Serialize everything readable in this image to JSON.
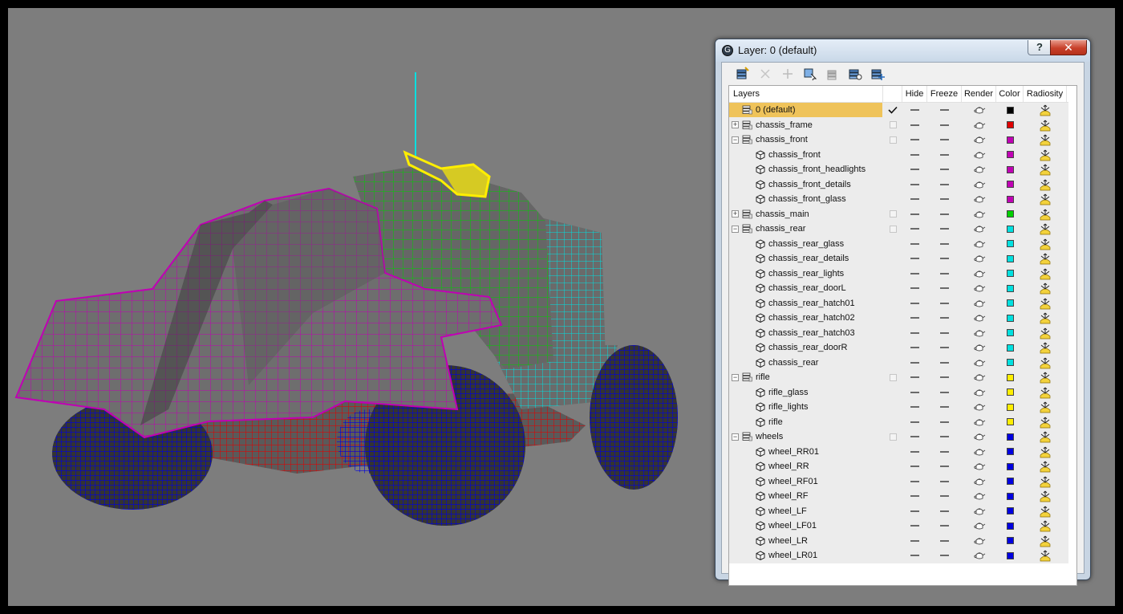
{
  "dialog": {
    "title": "Layer: 0 (default)",
    "help_label": "?",
    "close_label": "✕",
    "app_icon_label": "G"
  },
  "toolbar": {
    "buttons": [
      {
        "name": "create-layer-icon"
      },
      {
        "name": "delete-layer-icon"
      },
      {
        "name": "add-selected-icon"
      },
      {
        "name": "select-objects-icon"
      },
      {
        "name": "highlight-icon"
      },
      {
        "name": "hide-unhide-all-icon"
      },
      {
        "name": "freeze-unfreeze-all-icon"
      }
    ]
  },
  "columns": {
    "layers": "Layers",
    "hide": "Hide",
    "freeze": "Freeze",
    "render": "Render",
    "color": "Color",
    "radiosity": "Radiosity"
  },
  "colors": {
    "black": "#000000",
    "red": "#e00000",
    "magenta": "#c000b4",
    "green": "#00d000",
    "cyan": "#00e0e0",
    "yellow": "#ffee00",
    "blue": "#0000e0"
  },
  "rows": [
    {
      "label": "0 (default)",
      "kind": "layer",
      "level": 0,
      "expander": "",
      "color": "#000000",
      "selected": true,
      "current": true
    },
    {
      "label": "chassis_frame",
      "kind": "layer",
      "level": 0,
      "expander": "+",
      "color": "#e00000"
    },
    {
      "label": "chassis_front",
      "kind": "layer",
      "level": 0,
      "expander": "−",
      "color": "#c000b4"
    },
    {
      "label": "chassis_front",
      "kind": "object",
      "level": 1,
      "color": "#c000b4"
    },
    {
      "label": "chassis_front_headlights",
      "kind": "object",
      "level": 1,
      "color": "#c000b4"
    },
    {
      "label": "chassis_front_details",
      "kind": "object",
      "level": 1,
      "color": "#c000b4"
    },
    {
      "label": "chassis_front_glass",
      "kind": "object",
      "level": 1,
      "color": "#c000b4"
    },
    {
      "label": "chassis_main",
      "kind": "layer",
      "level": 0,
      "expander": "+",
      "color": "#00d000"
    },
    {
      "label": "chassis_rear",
      "kind": "layer",
      "level": 0,
      "expander": "−",
      "color": "#00e0e0"
    },
    {
      "label": "chassis_rear_glass",
      "kind": "object",
      "level": 1,
      "color": "#00e0e0"
    },
    {
      "label": "chassis_rear_details",
      "kind": "object",
      "level": 1,
      "color": "#00e0e0"
    },
    {
      "label": "chassis_rear_lights",
      "kind": "object",
      "level": 1,
      "color": "#00e0e0"
    },
    {
      "label": "chassis_rear_doorL",
      "kind": "object",
      "level": 1,
      "color": "#00e0e0"
    },
    {
      "label": "chassis_rear_hatch01",
      "kind": "object",
      "level": 1,
      "color": "#00e0e0"
    },
    {
      "label": "chassis_rear_hatch02",
      "kind": "object",
      "level": 1,
      "color": "#00e0e0"
    },
    {
      "label": "chassis_rear_hatch03",
      "kind": "object",
      "level": 1,
      "color": "#00e0e0"
    },
    {
      "label": "chassis_rear_doorR",
      "kind": "object",
      "level": 1,
      "color": "#00e0e0"
    },
    {
      "label": "chassis_rear",
      "kind": "object",
      "level": 1,
      "color": "#00e0e0"
    },
    {
      "label": "rifle",
      "kind": "layer",
      "level": 0,
      "expander": "−",
      "color": "#ffee00"
    },
    {
      "label": "rifle_glass",
      "kind": "object",
      "level": 1,
      "color": "#ffee00"
    },
    {
      "label": "rifle_lights",
      "kind": "object",
      "level": 1,
      "color": "#ffee00"
    },
    {
      "label": "rifle",
      "kind": "object",
      "level": 1,
      "color": "#ffee00"
    },
    {
      "label": "wheels",
      "kind": "layer",
      "level": 0,
      "expander": "−",
      "color": "#0000e0"
    },
    {
      "label": "wheel_RR01",
      "kind": "object",
      "level": 1,
      "color": "#0000e0"
    },
    {
      "label": "wheel_RR",
      "kind": "object",
      "level": 1,
      "color": "#0000e0"
    },
    {
      "label": "wheel_RF01",
      "kind": "object",
      "level": 1,
      "color": "#0000e0"
    },
    {
      "label": "wheel_RF",
      "kind": "object",
      "level": 1,
      "color": "#0000e0"
    },
    {
      "label": "wheel_LF",
      "kind": "object",
      "level": 1,
      "color": "#0000e0"
    },
    {
      "label": "wheel_LF01",
      "kind": "object",
      "level": 1,
      "color": "#0000e0"
    },
    {
      "label": "wheel_LR",
      "kind": "object",
      "level": 1,
      "color": "#0000e0"
    },
    {
      "label": "wheel_LR01",
      "kind": "object",
      "level": 1,
      "color": "#0000e0"
    }
  ]
}
